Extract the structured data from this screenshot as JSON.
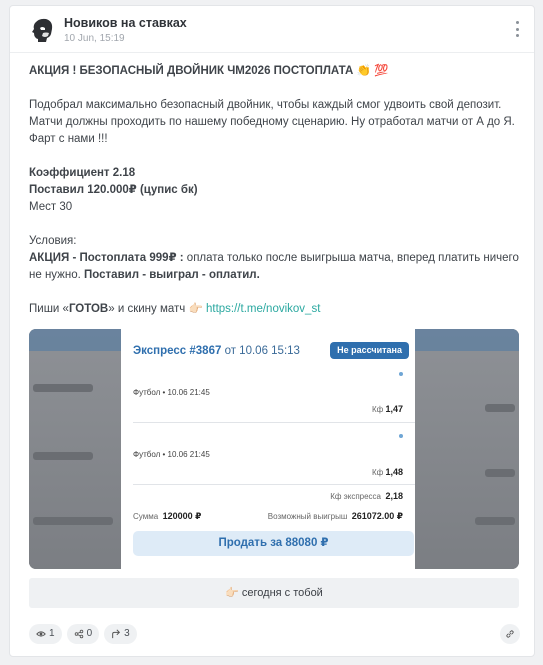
{
  "post": {
    "channel_name": "Новиков на ставках",
    "date": "10 Jun, 15:19",
    "title": "АКЦИЯ ! БЕЗОПАСНЫЙ ДВОЙНИК ЧМ2026 ПОСТОПЛАТА 👏 💯",
    "paragraph1": "Подобрал максимально безопасный двойник, чтобы каждый смог удвоить свой депозит. Матчи должны проходить по нашему победному сценарию. Ну отработал матчи от А до Я. Фарт с нами !!!",
    "coef": "Коэффициент 2.18",
    "stake": "Поставил 120.000₽ (цупис бк)",
    "places": "Мест 30",
    "conditions_label": "Условия:",
    "promo_bold": "АКЦИЯ - Постоплата 999₽ :",
    "promo_text": " оплата только после выигрыша матча, вперед платить ничего не нужно. ",
    "promo_end": "Поставил - выиграл - оплатил.",
    "cta_prefix": "Пиши «",
    "cta_word": "ГОТОВ",
    "cta_suffix": "» и скину матч 👉🏻 ",
    "link": "https://t.me/novikov_st"
  },
  "bet_slip": {
    "title": "Экспресс",
    "number": "#3867",
    "date_text": "от 10.06 15:13",
    "status": "Не рассчитана",
    "events": [
      {
        "sport_date": "Футбол • 10.06 21:45",
        "kf_label": "Кф",
        "kf": "1,47"
      },
      {
        "sport_date": "Футбол • 10.06 21:45",
        "kf_label": "Кф",
        "kf": "1,48"
      }
    ],
    "express_kf_label": "Кф экспресса",
    "express_kf": "2,18",
    "sum_label": "Сумма",
    "sum": "120000 ₽",
    "win_label": "Возможный выигрыш",
    "win": "261072.00 ₽",
    "sell_button": "Продать за 88080 ₽"
  },
  "reaction_button": "👉🏻 сегодня с тобой",
  "stats": {
    "views": "1",
    "shares": "0",
    "forwards": "3"
  },
  "colors": {
    "accent": "#2f6fae",
    "link": "#2aa8a0",
    "badge": "#2f6fae"
  }
}
